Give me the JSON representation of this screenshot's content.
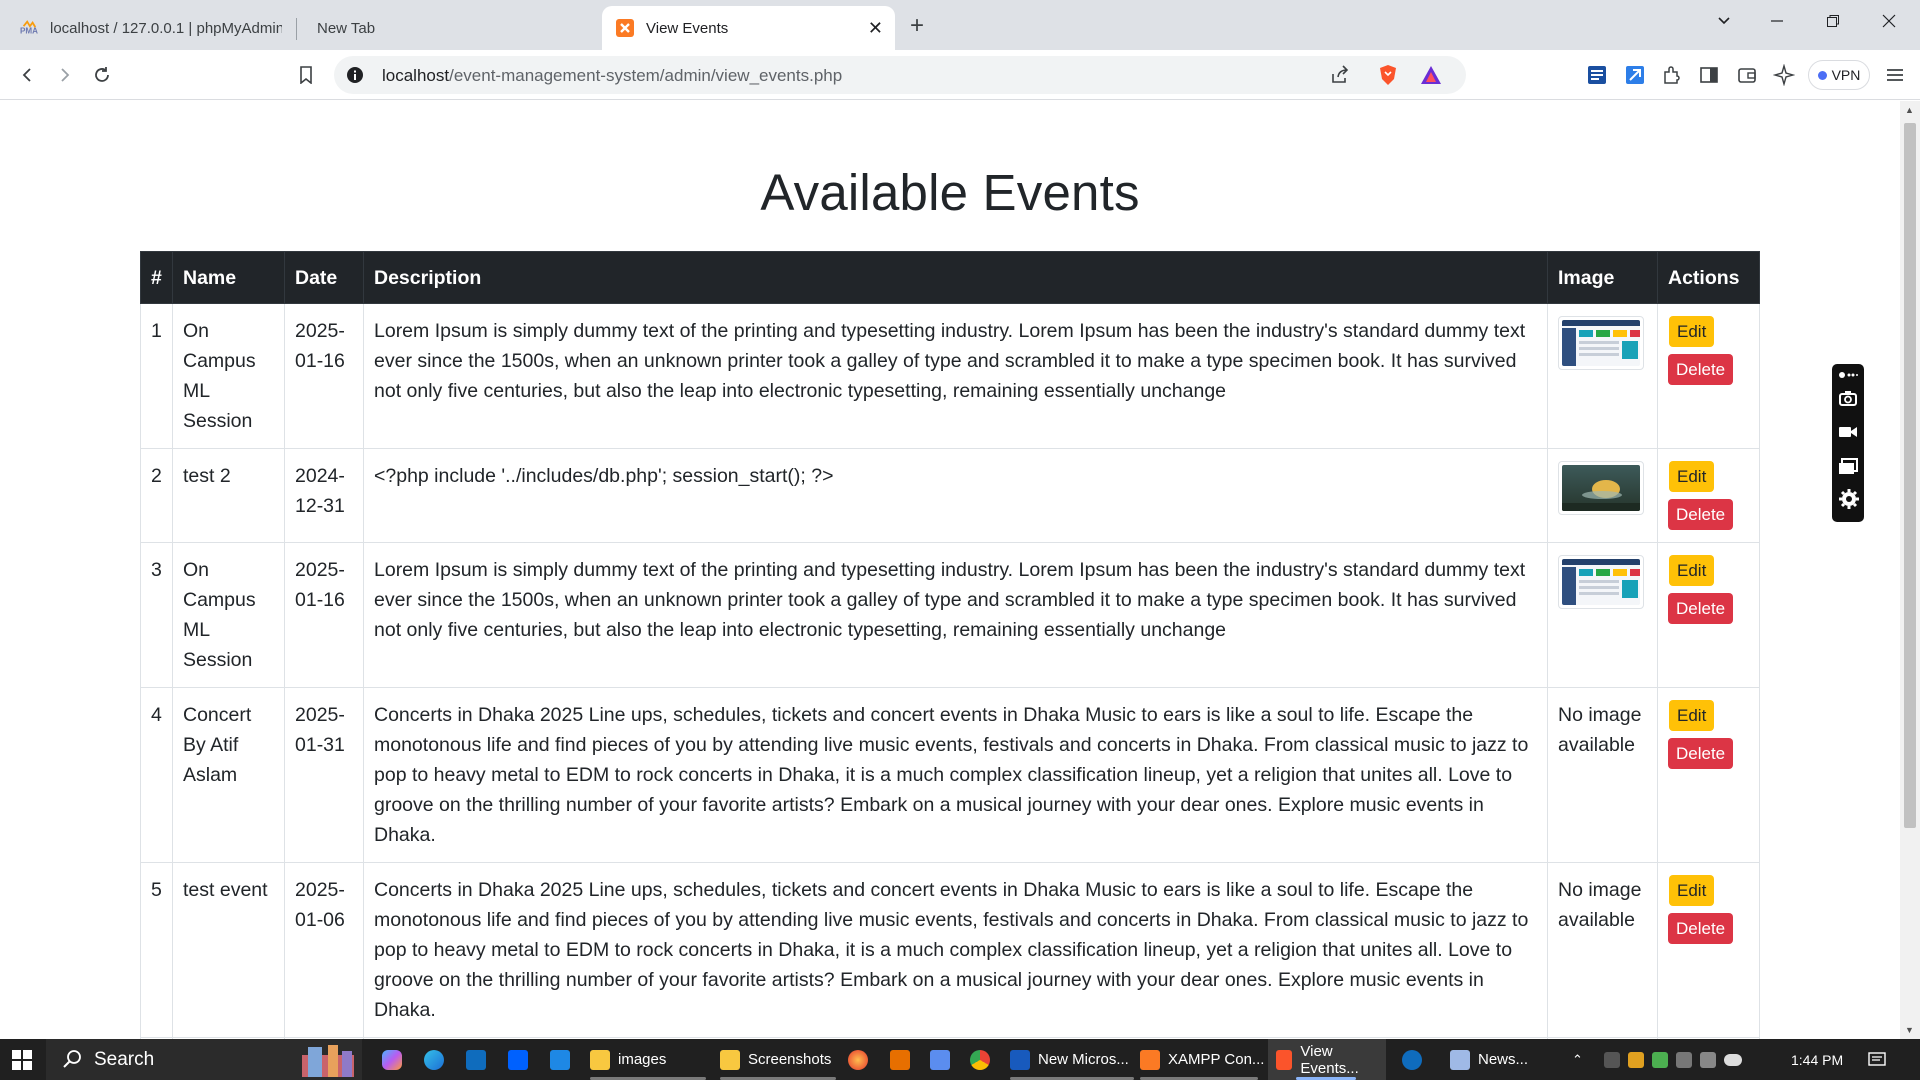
{
  "browser": {
    "tabs": [
      {
        "label": "localhost / 127.0.0.1 | phpMyAdmin"
      },
      {
        "label": "New Tab"
      },
      {
        "label": "View Events"
      }
    ],
    "url_host": "localhost",
    "url_path": "/event-management-system/admin/view_events.php",
    "vpn_label": "VPN"
  },
  "page": {
    "title": "Available Events",
    "columns": [
      "#",
      "Name",
      "Date",
      "Description",
      "Image",
      "Actions"
    ],
    "edit_label": "Edit",
    "delete_label": "Delete",
    "no_image_label": "No image available",
    "events": [
      {
        "num": "1",
        "name": "On Campus ML Session",
        "date": "2025-01-16",
        "description": "Lorem Ipsum is simply dummy text of the printing and typesetting industry. Lorem Ipsum has been the industry's standard dummy text ever since the 1500s, when an unknown printer took a galley of type and scrambled it to make a type specimen book. It has survived not only five centuries, but also the leap into electronic typesetting, remaining essentially unchange",
        "image": "screenshot-thumbnail"
      },
      {
        "num": "2",
        "name": "test 2",
        "date": "2024-12-31",
        "description": "<?php include '../includes/db.php'; session_start(); ?>",
        "image": "photo-thumbnail"
      },
      {
        "num": "3",
        "name": "On Campus ML Session",
        "date": "2025-01-16",
        "description": "Lorem Ipsum is simply dummy text of the printing and typesetting industry. Lorem Ipsum has been the industry's standard dummy text ever since the 1500s, when an unknown printer took a galley of type and scrambled it to make a type specimen book. It has survived not only five centuries, but also the leap into electronic typesetting, remaining essentially unchange",
        "image": "screenshot-thumbnail"
      },
      {
        "num": "4",
        "name": "Concert By Atif Aslam",
        "date": "2025-01-31",
        "description": "Concerts in Dhaka 2025 Line ups, schedules, tickets and concert events in Dhaka Music to ears is like a soul to life. Escape the monotonous life and find pieces of you by attending live music events, festivals and concerts in Dhaka. From classical music to jazz to pop to heavy metal to EDM to rock concerts in Dhaka, it is a much complex classification lineup, yet a religion that unites all. Love to groove on the thrilling number of your favorite artists? Embark on a musical journey with your dear ones. Explore music events in Dhaka.",
        "image": ""
      },
      {
        "num": "5",
        "name": "test event",
        "date": "2025-01-06",
        "description": "Concerts in Dhaka 2025 Line ups, schedules, tickets and concert events in Dhaka Music to ears is like a soul to life. Escape the monotonous life and find pieces of you by attending live music events, festivals and concerts in Dhaka. From classical music to jazz to pop to heavy metal to EDM to rock concerts in Dhaka, it is a much complex classification lineup, yet a religion that unites all. Love to groove on the thrilling number of your favorite artists? Embark on a musical journey with your dear ones. Explore music events in Dhaka.",
        "image": ""
      }
    ]
  },
  "taskbar": {
    "search_label": "Search",
    "items": [
      {
        "label": "images"
      },
      {
        "label": "Screenshots"
      },
      {
        "label": "New Micros..."
      },
      {
        "label": "XAMPP Con..."
      },
      {
        "label": "View Events..."
      },
      {
        "label": "News..."
      }
    ],
    "time": "1:44 PM"
  },
  "colors": {
    "header_bg": "#212529",
    "edit": "#ffc107",
    "delete": "#dc3545"
  }
}
